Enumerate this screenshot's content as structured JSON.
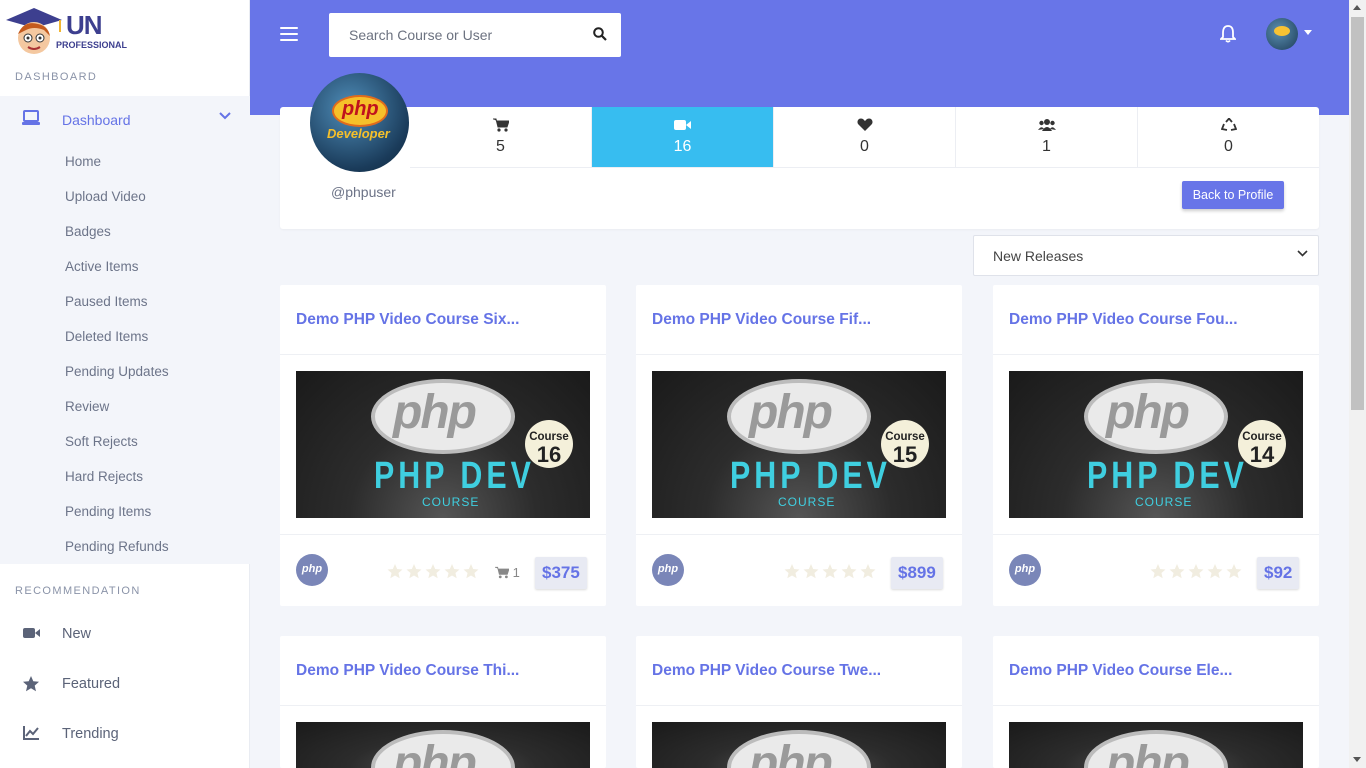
{
  "brand": {
    "line1": "UN",
    "line2": "PROFESSIONAL"
  },
  "sidebar": {
    "section_dashboard": "DASHBOARD",
    "dashboard_label": "Dashboard",
    "sub_items": [
      "Home",
      "Upload Video",
      "Badges",
      "Active Items",
      "Paused Items",
      "Deleted Items",
      "Pending Updates",
      "Review",
      "Soft Rejects",
      "Hard Rejects",
      "Pending Items",
      "Pending Refunds"
    ],
    "section_recommendation": "RECOMMENDATION",
    "rec_items": [
      {
        "label": "New",
        "icon": "video-camera-icon"
      },
      {
        "label": "Featured",
        "icon": "star-icon"
      },
      {
        "label": "Trending",
        "icon": "chart-line-icon"
      }
    ]
  },
  "header": {
    "search_placeholder": "Search Course or User"
  },
  "profile": {
    "username": "@phpuser",
    "avatar_text1": "php",
    "avatar_text2": "Developer",
    "back_button": "Back to Profile",
    "stats": [
      {
        "icon": "cart-icon",
        "value": "5"
      },
      {
        "icon": "video-camera-icon",
        "value": "16",
        "active": true
      },
      {
        "icon": "heart-icon",
        "value": "0"
      },
      {
        "icon": "users-icon",
        "value": "1"
      },
      {
        "icon": "recycle-icon",
        "value": "0"
      }
    ]
  },
  "sort": {
    "selected": "New Releases"
  },
  "thumb": {
    "logo": "php",
    "course_word": "Course",
    "dev": "PHP DEV",
    "course_caps": "COURSE"
  },
  "author_badge": "php",
  "courses": [
    {
      "title": "Demo PHP Video Course Six...",
      "number": "16",
      "price": "$375",
      "sales": "1"
    },
    {
      "title": "Demo PHP Video Course Fif...",
      "number": "15",
      "price": "$899"
    },
    {
      "title": "Demo PHP Video Course Fou...",
      "number": "14",
      "price": "$92"
    },
    {
      "title": "Demo PHP Video Course Thi...",
      "number": ""
    },
    {
      "title": "Demo PHP Video Course Twe...",
      "number": ""
    },
    {
      "title": "Demo PHP Video Course Ele...",
      "number": ""
    }
  ],
  "colors": {
    "primary": "#6875e8",
    "accent": "#37bdf0",
    "sidebar_bg": "#f3f5fa"
  }
}
